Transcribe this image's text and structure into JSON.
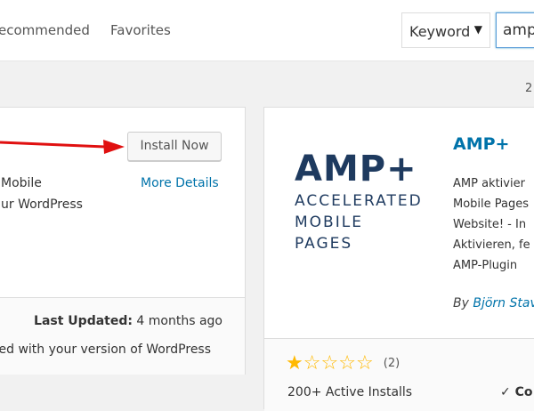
{
  "filter_bar": {
    "tabs": [
      "ecommended",
      "Favorites"
    ],
    "search_type": "Keyword",
    "search_value": "amp"
  },
  "results_count": "2",
  "card_left": {
    "install_label": "Install Now",
    "more_details_label": "More Details",
    "description_lines": [
      "Mobile",
      "ur WordPress"
    ],
    "last_updated_label": "Last Updated:",
    "last_updated_value": "4 months ago",
    "compatibility": "ted with your version of WordPress"
  },
  "card_right": {
    "logo": {
      "main": "AMP+",
      "lines": [
        "ACCELERATED",
        "MOBILE",
        "PAGES"
      ]
    },
    "title": "AMP+",
    "description_lines": [
      "AMP aktivier",
      "Mobile Pages",
      "Website! - In",
      "Aktivieren, fe",
      "AMP-Plugin"
    ],
    "author_prefix": "By",
    "author_name": "Björn Stav",
    "rating": {
      "filled": 1,
      "total": 5,
      "count": "(2)"
    },
    "active_installs": "200+ Active Installs",
    "compatibility": "Co"
  },
  "colors": {
    "link": "#0073aa",
    "star": "#ffb900",
    "arrow": "#e01010",
    "logo": "#1e3a5f"
  }
}
